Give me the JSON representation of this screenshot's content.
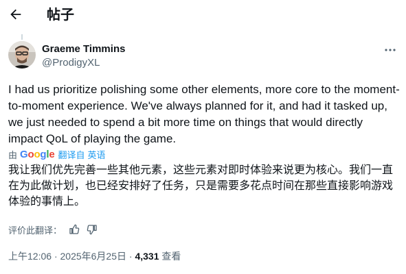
{
  "header": {
    "back_icon": "arrow-left-icon",
    "title": "帖子"
  },
  "post": {
    "author": {
      "name": "Graeme Timmins",
      "handle": "@ProdigyXL"
    },
    "more_icon": "more-horizontal-icon",
    "text": "I had us prioritize polishing some other elements, more core to the moment-to-moment experience. We've always planned for it, and had it tasked up, we just needed to spend a bit more time on things that would directly impact QoL of playing the game.",
    "translation": {
      "by": "由",
      "provider": "Google",
      "translate_from": "翻译自",
      "language": "英语",
      "text": "我让我们优先完善一些其他元素，这些元素对即时体验来说更为核心。我们一直在为此做计划，也已经安排好了任务，只是需要多花点时间在那些直接影响游戏体验的事情上。"
    },
    "rate_translation": {
      "label": "评价此翻译：",
      "like_icon": "thumbs-up-icon",
      "dislike_icon": "thumbs-down-icon"
    },
    "meta": {
      "time": "上午12:06",
      "separator": "·",
      "date": "2025年6月25日",
      "views": "4,331",
      "views_label": "查看"
    }
  },
  "colors": {
    "text": "#0f1419",
    "secondary": "#536471",
    "link": "#1d9bf0",
    "google_blue": "#4285f4",
    "google_red": "#ea4335",
    "google_yellow": "#fbbc05",
    "google_green": "#34a853"
  }
}
